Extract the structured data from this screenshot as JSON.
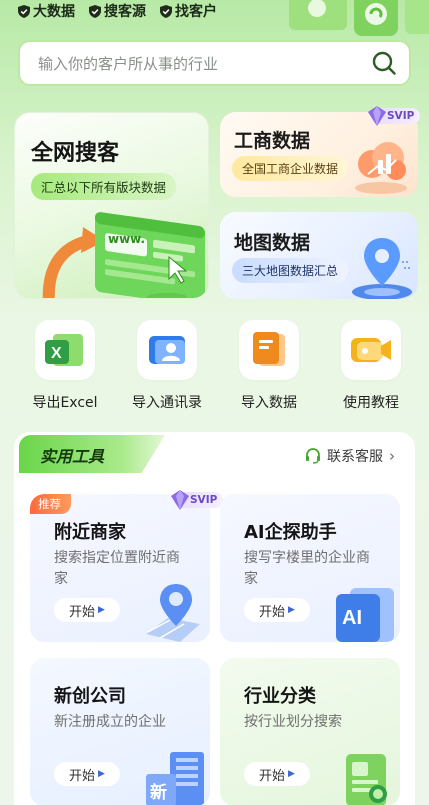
{
  "top_badges": [
    "大数据",
    "搜客源",
    "找客户"
  ],
  "search": {
    "placeholder": "输入你的客户所从事的行业"
  },
  "cards": {
    "big": {
      "title": "全网搜客",
      "subtitle": "汇总以下所有版块数据",
      "art_text": "www."
    },
    "business": {
      "title": "工商数据",
      "subtitle": "全国工商企业数据",
      "badge": "SVIP"
    },
    "map": {
      "title": "地图数据",
      "subtitle": "三大地图数据汇总"
    }
  },
  "quick_actions": [
    {
      "label": "导出Excel",
      "icon": "excel-icon",
      "color": "#2f9e44"
    },
    {
      "label": "导入通讯录",
      "icon": "contacts-icon",
      "color": "#2f7be8"
    },
    {
      "label": "导入数据",
      "icon": "import-data-icon",
      "color": "#f08a1d"
    },
    {
      "label": "使用教程",
      "icon": "video-tutorial-icon",
      "color": "#f6b21b"
    }
  ],
  "tools": {
    "title": "实用工具",
    "service": "联系客服",
    "items": [
      {
        "title": "附近商家",
        "desc": "搜索指定位置附近商家",
        "start": "开始",
        "tag": "推荐",
        "badge": "SVIP"
      },
      {
        "title": "AI企探助手",
        "desc": "搜写字楼里的企业商家",
        "start": "开始",
        "art_text": "AI"
      },
      {
        "title": "新创公司",
        "desc": "新注册成立的企业",
        "start": "开始",
        "art_text": "新"
      },
      {
        "title": "行业分类",
        "desc": "按行业划分搜索",
        "start": "开始"
      }
    ]
  }
}
